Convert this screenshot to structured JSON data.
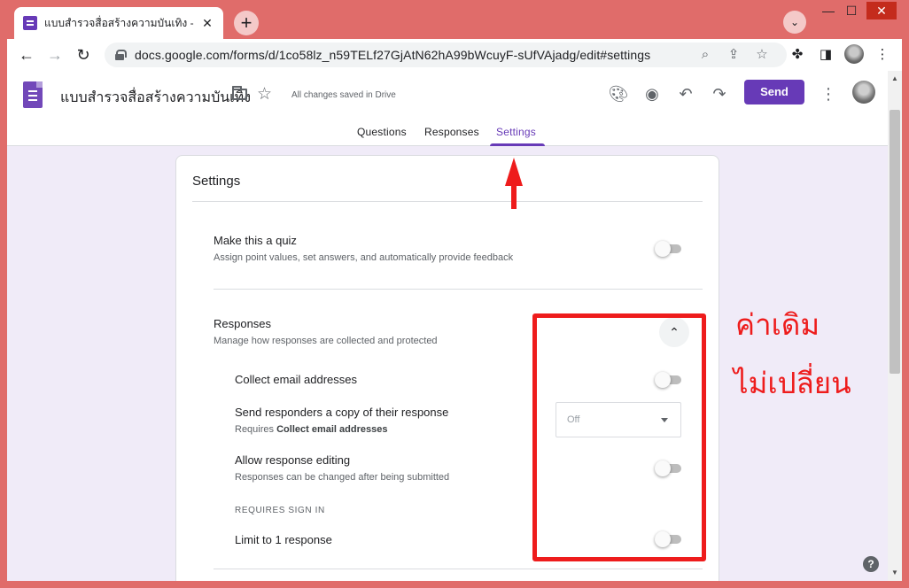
{
  "browser": {
    "tab_title": "แบบสำรวจสื่อสร้างความบันเทิง - Goo",
    "tab_close": "✕",
    "new_tab": "+",
    "tab_search": "⌄",
    "window_controls": {
      "minimize": "—",
      "maximize": "☐",
      "close": "✕"
    },
    "url": "docs.google.com/forms/d/1co58lz_n59TELf27GjAtN62hA99bWcuyF-sUfVAjadg/edit#settings"
  },
  "header": {
    "doc_title": "แบบสำรวจสื่อสร้างความบันเทิง",
    "save_status": "All changes saved in Drive",
    "send_label": "Send"
  },
  "form_tabs": [
    {
      "label": "Questions"
    },
    {
      "label": "Responses"
    },
    {
      "label": "Settings"
    }
  ],
  "settings": {
    "title": "Settings",
    "quiz": {
      "title": "Make this a quiz",
      "subtitle": "Assign point values, set answers, and automatically provide feedback",
      "enabled": false
    },
    "responses": {
      "title": "Responses",
      "subtitle": "Manage how responses are collected and protected",
      "collect_email": {
        "label": "Collect email addresses",
        "enabled": false
      },
      "send_copy": {
        "label": "Send responders a copy of their response",
        "requires_prefix": "Requires",
        "requires_bold": "Collect email addresses",
        "value": "Off"
      },
      "allow_editing": {
        "label": "Allow response editing",
        "subtitle": "Responses can be changed after being submitted",
        "enabled": false
      },
      "requires_sign_in": "REQUIRES SIGN IN",
      "limit_one": {
        "label": "Limit to 1 response",
        "enabled": false
      }
    }
  },
  "annotations": {
    "note_line1": "ค่าเดิม",
    "note_line2": "ไม่เปลี่ยน",
    "color": "#ee1c1c"
  },
  "help_icon": "?",
  "colors": {
    "accent": "#673ab7",
    "page_bg": "#f0ebf8",
    "window_frame": "#e06c6a"
  }
}
